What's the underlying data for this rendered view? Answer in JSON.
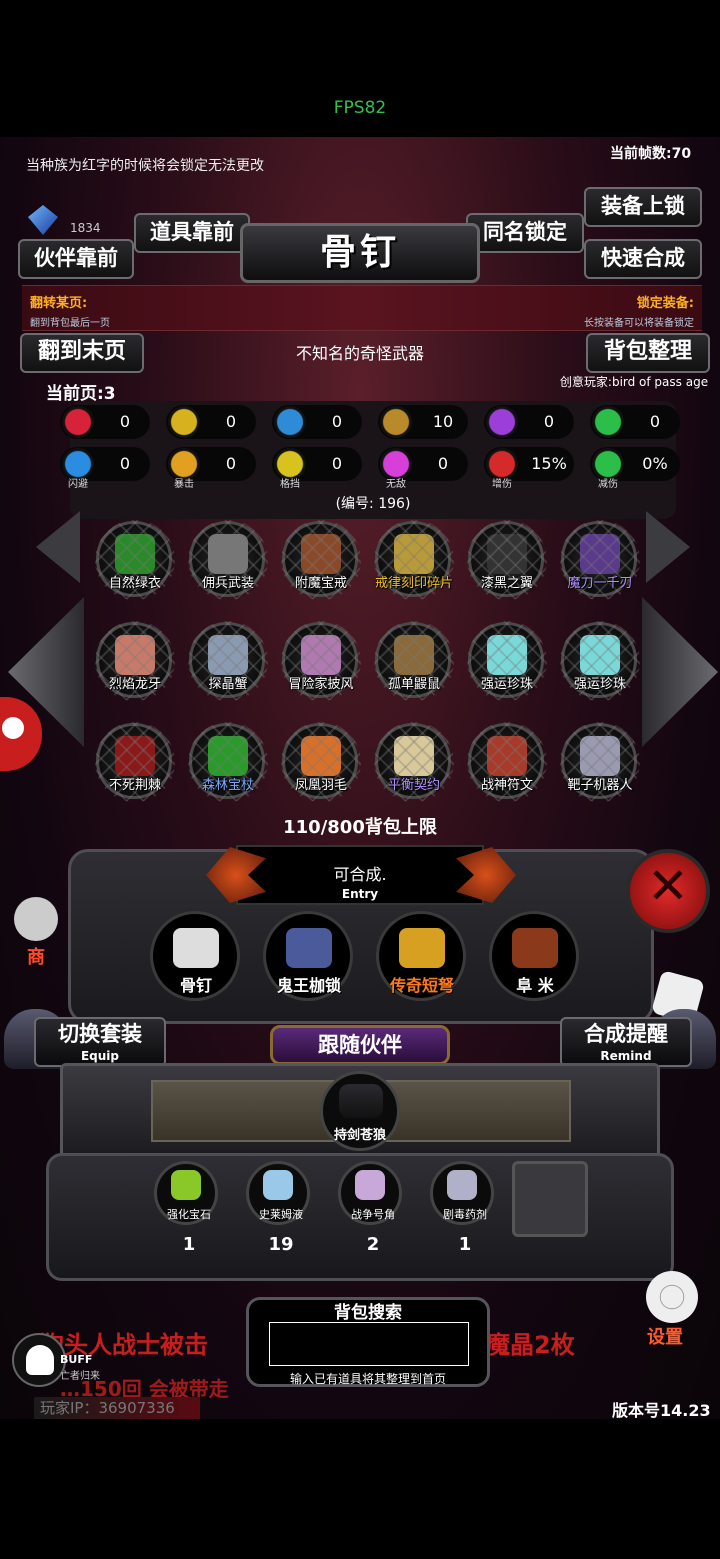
{
  "hud": {
    "fps": "FPS82",
    "notice": "当种族为红字的时候将会锁定无法更改",
    "frame_rate": "当前帧数:70",
    "gem_count": "1834",
    "version": "版本号14.23",
    "player_ip": "玩家IP：36907336",
    "settings_label": "设置",
    "shop_label": "商"
  },
  "top_buttons": {
    "equip_lock": "装备上锁",
    "item_front": "道具靠前",
    "name_lock": "同名锁定",
    "partner_front": "伙伴靠前",
    "quick_synth": "快速合成",
    "jump_last": "翻到末页",
    "bag_sort": "背包整理"
  },
  "item_panel": {
    "title": "骨钉",
    "flip_title": "翻转某页:",
    "flip_desc": "翻到背包最后一页",
    "lock_title": "锁定装备:",
    "lock_desc": "长按装备可以将装备锁定",
    "description": "不知名的奇怪武器",
    "current_page": "当前页:3",
    "creator": "创意玩家:bird of pass age",
    "item_id": "(编号: 196)"
  },
  "stats": [
    {
      "icon": "heart-icon",
      "color": "#d6233a",
      "value": "0",
      "label": ""
    },
    {
      "icon": "fist-icon",
      "color": "#d8b21e",
      "value": "0",
      "label": ""
    },
    {
      "icon": "armor-icon",
      "color": "#2d8bd8",
      "value": "0",
      "label": ""
    },
    {
      "icon": "sword-up-icon",
      "color": "#b98a2a",
      "value": "10",
      "label": ""
    },
    {
      "icon": "lightning-icon",
      "color": "#9b3fd8",
      "value": "0",
      "label": ""
    },
    {
      "icon": "clover-icon",
      "color": "#2bbf4a",
      "value": "0",
      "label": ""
    },
    {
      "icon": "dodge-icon",
      "color": "#2a8de0",
      "value": "0",
      "label": "闪避"
    },
    {
      "icon": "crit-icon",
      "color": "#e0a020",
      "value": "0",
      "label": "暴击"
    },
    {
      "icon": "block-icon",
      "color": "#d8c21e",
      "value": "0",
      "label": "格挡"
    },
    {
      "icon": "invincible-icon",
      "color": "#d63fd8",
      "value": "0",
      "label": "无敌"
    },
    {
      "icon": "dmg-up-icon",
      "color": "#d62a2a",
      "value": "15%",
      "label": "增伤"
    },
    {
      "icon": "dmg-down-icon",
      "color": "#2bbf4a",
      "value": "0%",
      "label": "减伤"
    }
  ],
  "inventory": [
    {
      "name": "自然绿衣",
      "color": "#2a8a2a",
      "name_color": "#ffffff"
    },
    {
      "name": "佣兵武装",
      "color": "#777777",
      "name_color": "#ffffff"
    },
    {
      "name": "附魔宝戒",
      "color": "#8a4a2a",
      "name_color": "#ffffff"
    },
    {
      "name": "戒律刻印碎片",
      "color": "#b99a3a",
      "name_color": "#f0c020"
    },
    {
      "name": "漆黑之翼",
      "color": "#333333",
      "name_color": "#ffffff"
    },
    {
      "name": "魔刀一千刃",
      "color": "#5a3a8a",
      "name_color": "#b18cff"
    },
    {
      "name": "烈焰龙牙",
      "color": "#c87a6a",
      "name_color": "#ffffff"
    },
    {
      "name": "探晶蟹",
      "color": "#8a9ab0",
      "name_color": "#ffffff"
    },
    {
      "name": "冒险家披风",
      "color": "#b07ab0",
      "name_color": "#ffffff"
    },
    {
      "name": "孤单鼹鼠",
      "color": "#8a6a3a",
      "name_color": "#ffffff"
    },
    {
      "name": "强运珍珠",
      "color": "#7ad8d8",
      "name_color": "#ffffff"
    },
    {
      "name": "强运珍珠",
      "color": "#7ad8d8",
      "name_color": "#ffffff"
    },
    {
      "name": "不死荆棘",
      "color": "#8a1a1a",
      "name_color": "#ffffff"
    },
    {
      "name": "森林宝杖",
      "color": "#2a9a2a",
      "name_color": "#7aa8ff"
    },
    {
      "name": "凤凰羽毛",
      "color": "#d8702a",
      "name_color": "#ffffff"
    },
    {
      "name": "平衡契约",
      "color": "#d8c89a",
      "name_color": "#b18cff"
    },
    {
      "name": "战神符文",
      "color": "#a83a2a",
      "name_color": "#ffffff"
    },
    {
      "name": "靶子机器人",
      "color": "#9a9ab0",
      "name_color": "#ffffff"
    }
  ],
  "bag": {
    "capacity": "110/800背包上限",
    "synth_status": "可合成.",
    "synth_sub": "Entry"
  },
  "equipped": [
    {
      "name": "骨钉",
      "color": "#dddddd",
      "name_color": "#ffffff"
    },
    {
      "name": "鬼王枷锁",
      "color": "#4a5a9a",
      "name_color": "#ffffff"
    },
    {
      "name": "传奇短弩",
      "color": "#d8a020",
      "name_color": "#ff7a1a"
    },
    {
      "name": "阜 米",
      "color": "#8a3a1a",
      "name_color": "#ffffff"
    }
  ],
  "lower": {
    "switch_set": "切换套装",
    "switch_set_sub": "Equip",
    "follow_partner": "跟随伙伴",
    "synth_remind": "合成提醒",
    "synth_remind_sub": "Remind",
    "partner_name": "持剑苍狼"
  },
  "consumables": [
    {
      "name": "强化宝石",
      "count": "1",
      "color": "#8ac82a"
    },
    {
      "name": "史莱姆液",
      "count": "19",
      "color": "#9ac8e8"
    },
    {
      "name": "战争号角",
      "count": "2",
      "color": "#c8a8d8"
    },
    {
      "name": "剧毒药剂",
      "count": "1",
      "color": "#b0b0c8"
    }
  ],
  "search": {
    "title": "背包搜索",
    "value": "",
    "hint": "输入已有道具将其整理到首页"
  },
  "ticker": {
    "left": "狗头人战士被击",
    "right": "魔晶2枚",
    "line2": "…150回 会被带走"
  },
  "buff": {
    "label": "BUFF",
    "sub": "亡者归来"
  }
}
